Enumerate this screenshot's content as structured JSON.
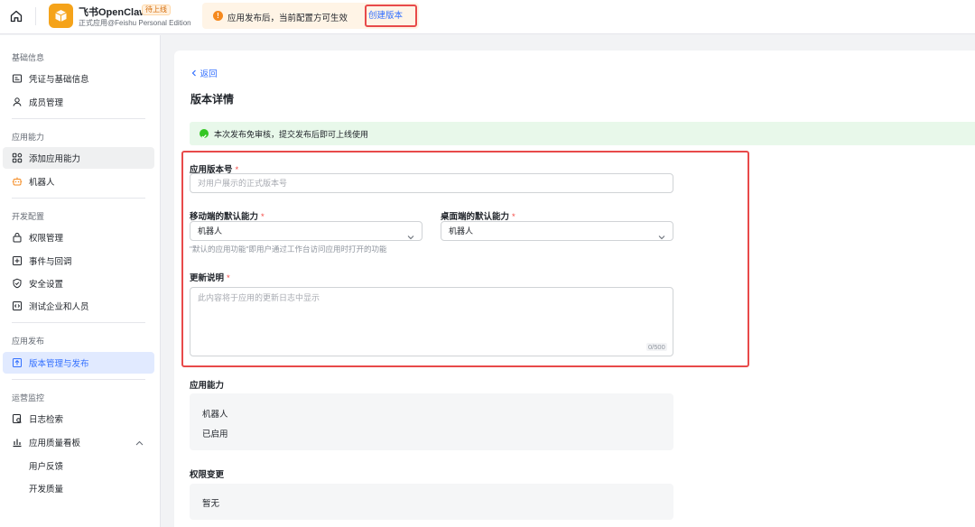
{
  "topbar": {
    "app_name": "飞书OpenClaw",
    "status_badge": "待上线",
    "app_edition": "正式应用@Feishu Personal Edition",
    "notice_text": "应用发布后，当前配置方可生效",
    "create_version_label": "创建版本",
    "warn_glyph": "!"
  },
  "sidebar": {
    "sections": [
      {
        "title": "基础信息",
        "items": [
          "凭证与基础信息",
          "成员管理"
        ]
      },
      {
        "title": "应用能力",
        "items": [
          "添加应用能力",
          "机器人"
        ]
      },
      {
        "title": "开发配置",
        "items": [
          "权限管理",
          "事件与回调",
          "安全设置",
          "测试企业和人员"
        ]
      },
      {
        "title": "应用发布",
        "items": [
          "版本管理与发布"
        ]
      },
      {
        "title": "运营监控",
        "items": [
          "日志检索",
          "应用质量看板",
          "用户反馈",
          "开发质量"
        ]
      }
    ]
  },
  "main": {
    "back_label": "返回",
    "page_title": "版本详情",
    "success_text": "本次发布免审核，提交发布后即可上线使用",
    "form": {
      "version_label": "应用版本号",
      "version_placeholder": "对用户展示的正式版本号",
      "mobile_label": "移动端的默认能力",
      "mobile_value": "机器人",
      "mobile_hint": "\"默认的应用功能\"即用户通过工作台访问应用时打开的功能",
      "desktop_label": "桌面端的默认能力",
      "desktop_value": "机器人",
      "notes_label": "更新说明",
      "notes_placeholder": "此内容将于应用的更新日志中显示",
      "notes_counter": "0/500",
      "required_mark": "*"
    },
    "capability": {
      "label": "应用能力",
      "name": "机器人",
      "status": "已启用"
    },
    "permission": {
      "label": "权限变更",
      "value": "暂无"
    }
  },
  "colors": {
    "accent": "#3370ff",
    "highlight_frame": "#e84a4a",
    "success_bg": "#e8f8ea",
    "notice_bg": "#fff4e6",
    "logo": "#f5a31a"
  }
}
